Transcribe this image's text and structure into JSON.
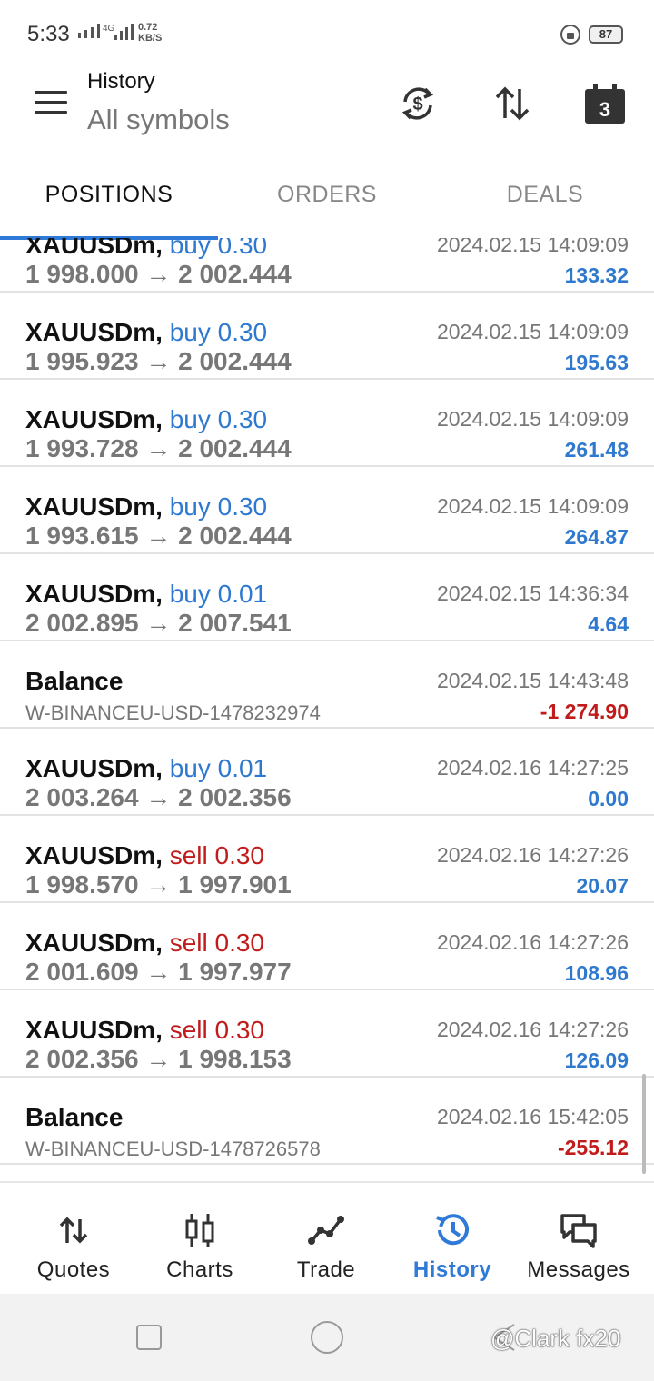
{
  "status_bar": {
    "time": "5:33",
    "network": "4G",
    "speed_value": "0.72",
    "speed_unit": "KB/S",
    "battery": "87"
  },
  "header": {
    "title": "History",
    "subtitle": "All symbols",
    "calendar_day": "3"
  },
  "tabs": [
    {
      "label": "POSITIONS",
      "active": true
    },
    {
      "label": "ORDERS",
      "active": false
    },
    {
      "label": "DEALS",
      "active": false
    }
  ],
  "rows": [
    {
      "type": "trade",
      "symbol": "XAUUSDm,",
      "side": "buy",
      "side_label": "buy 0.30",
      "prices": "1 998.000 → 2 002.444",
      "date": "2024.02.15 14:09:09",
      "profit": "133.32",
      "profit_sign": "pos"
    },
    {
      "type": "trade",
      "symbol": "XAUUSDm,",
      "side": "buy",
      "side_label": "buy 0.30",
      "prices": "1 995.923 → 2 002.444",
      "date": "2024.02.15 14:09:09",
      "profit": "195.63",
      "profit_sign": "pos"
    },
    {
      "type": "trade",
      "symbol": "XAUUSDm,",
      "side": "buy",
      "side_label": "buy 0.30",
      "prices": "1 993.728 → 2 002.444",
      "date": "2024.02.15 14:09:09",
      "profit": "261.48",
      "profit_sign": "pos"
    },
    {
      "type": "trade",
      "symbol": "XAUUSDm,",
      "side": "buy",
      "side_label": "buy 0.30",
      "prices": "1 993.615 → 2 002.444",
      "date": "2024.02.15 14:09:09",
      "profit": "264.87",
      "profit_sign": "pos"
    },
    {
      "type": "trade",
      "symbol": "XAUUSDm,",
      "side": "buy",
      "side_label": "buy 0.01",
      "prices": "2 002.895 → 2 007.541",
      "date": "2024.02.15 14:36:34",
      "profit": "4.64",
      "profit_sign": "pos"
    },
    {
      "type": "balance",
      "symbol": "Balance",
      "comment": "W-BINANCEU-USD-1478232974",
      "date": "2024.02.15 14:43:48",
      "profit": "-1 274.90",
      "profit_sign": "neg"
    },
    {
      "type": "trade",
      "symbol": "XAUUSDm,",
      "side": "buy",
      "side_label": "buy 0.01",
      "prices": "2 003.264 → 2 002.356",
      "date": "2024.02.16 14:27:25",
      "profit": "0.00",
      "profit_sign": "pos"
    },
    {
      "type": "trade",
      "symbol": "XAUUSDm,",
      "side": "sell",
      "side_label": "sell 0.30",
      "prices": "1 998.570 → 1 997.901",
      "date": "2024.02.16 14:27:26",
      "profit": "20.07",
      "profit_sign": "pos"
    },
    {
      "type": "trade",
      "symbol": "XAUUSDm,",
      "side": "sell",
      "side_label": "sell 0.30",
      "prices": "2 001.609 → 1 997.977",
      "date": "2024.02.16 14:27:26",
      "profit": "108.96",
      "profit_sign": "pos"
    },
    {
      "type": "trade",
      "symbol": "XAUUSDm,",
      "side": "sell",
      "side_label": "sell 0.30",
      "prices": "2 002.356 → 1 998.153",
      "date": "2024.02.16 14:27:26",
      "profit": "126.09",
      "profit_sign": "pos"
    },
    {
      "type": "balance",
      "symbol": "Balance",
      "comment": "W-BINANCEU-USD-1478726578",
      "date": "2024.02.16 15:42:05",
      "profit": "-255.12",
      "profit_sign": "neg"
    }
  ],
  "bottom_nav": [
    {
      "label": "Quotes",
      "icon": "quotes-arrows-icon",
      "active": false
    },
    {
      "label": "Charts",
      "icon": "candlestick-icon",
      "active": false
    },
    {
      "label": "Trade",
      "icon": "trade-line-icon",
      "active": false
    },
    {
      "label": "History",
      "icon": "history-clock-icon",
      "active": true
    },
    {
      "label": "Messages",
      "icon": "chat-bubbles-icon",
      "active": false
    }
  ],
  "watermark": "@Clark fx20",
  "colors": {
    "accent_blue": "#2f7ad6",
    "profit_blue": "#2e79cf",
    "loss_red": "#c11b1b",
    "muted_gray": "#777777"
  }
}
